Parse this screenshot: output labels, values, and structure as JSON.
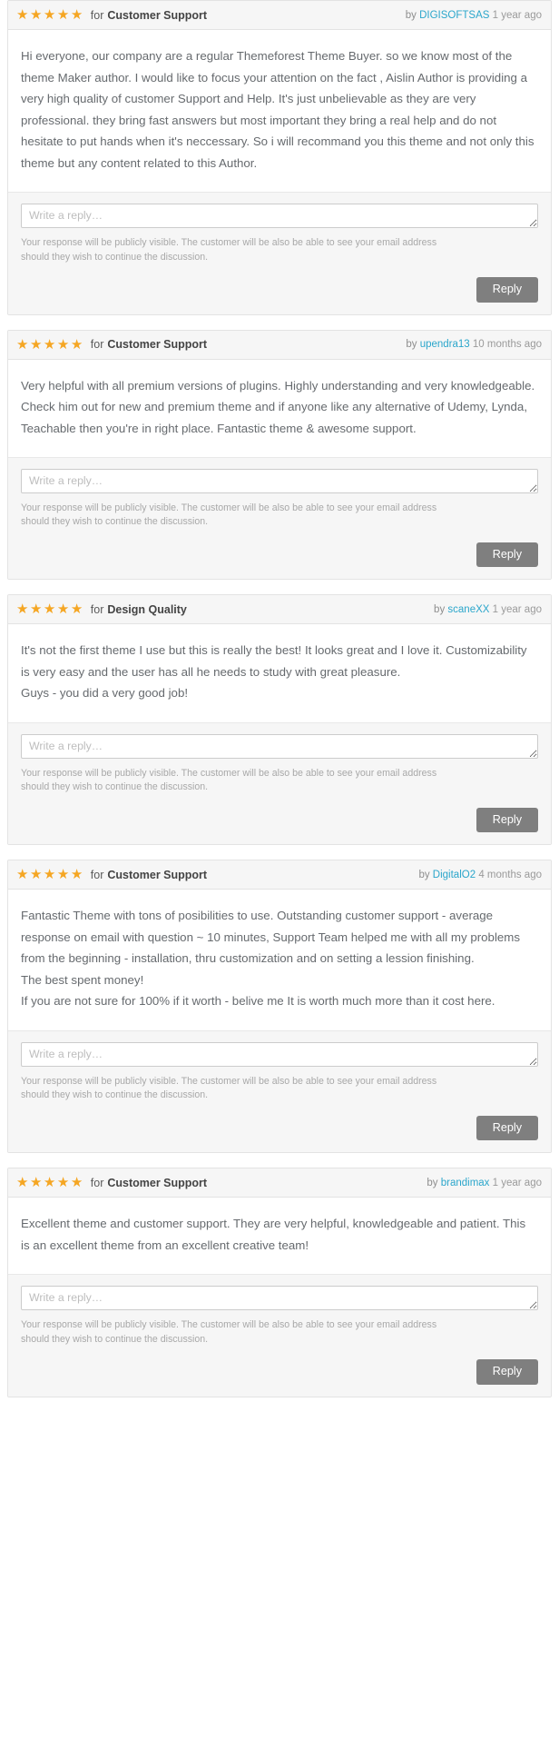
{
  "theme": {
    "star_color": "#f5a623",
    "link_color": "#2ba6cb",
    "button_color": "#7f7f7f",
    "header_bg": "#f6f6f6",
    "body_text_color": "#666a6e"
  },
  "common": {
    "for_label": "for",
    "by_label": "by",
    "reply_placeholder": "Write a reply…",
    "reply_value": "",
    "disclaimer": "Your response will be publicly visible. The customer will be also be able to see your email address should they wish to continue the discussion.",
    "reply_button_label": "Reply",
    "star_glyph": "★"
  },
  "reviews": [
    {
      "rating": 5,
      "criteria": "Customer Support",
      "author": "DIGISOFTSAS",
      "time_ago": "1 year ago",
      "body": "Hi everyone, our company are a regular Themeforest Theme Buyer. so we know most of the theme Maker author. I would like to focus your attention on the fact , Aislin Author is providing a very high quality of customer Support and Help. It's just unbelievable as they are very professional. they bring fast answers but most important they bring a real help and do not hesitate to put hands when it's neccessary. So i will recommand you this theme and not only this theme but any content related to this Author."
    },
    {
      "rating": 5,
      "criteria": "Customer Support",
      "author": "upendra13",
      "time_ago": "10 months ago",
      "body": "Very helpful with all premium versions of plugins. Highly understanding and very knowledgeable. Check him out for new and premium theme and if anyone like any alternative of Udemy, Lynda, Teachable then you're in right place. Fantastic theme & awesome support."
    },
    {
      "rating": 5,
      "criteria": "Design Quality",
      "author": "scaneXX",
      "time_ago": "1 year ago",
      "body": "It's not the first theme I use but this is really the best! It looks great and I love it. Customizability is very easy and the user has all he needs to study with great pleasure.\nGuys - you did a very good job!"
    },
    {
      "rating": 5,
      "criteria": "Customer Support",
      "author": "DigitalO2",
      "time_ago": "4 months ago",
      "body": "Fantastic Theme with tons of posibilities to use. Outstanding customer support - average response on email with question ~ 10 minutes, Support Team helped me with all my problems from the beginning - installation, thru customization and on setting a lession finishing.\nThe best spent money!\nIf you are not sure for 100% if it worth - belive me It is worth much more than it cost here."
    },
    {
      "rating": 5,
      "criteria": "Customer Support",
      "author": "brandimax",
      "time_ago": "1 year ago",
      "body": "Excellent theme and customer support. They are very helpful, knowledgeable and patient. This is an excellent theme from an excellent creative team!"
    }
  ]
}
